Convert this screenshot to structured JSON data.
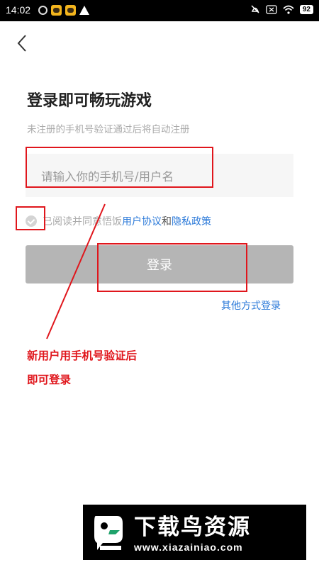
{
  "status_bar": {
    "time": "14:02",
    "battery": "92"
  },
  "page": {
    "title": "登录即可畅玩游戏",
    "subtitle": "未注册的手机号验证通过后将自动注册",
    "phone_placeholder": "请输入你的手机号/用户名",
    "agree_prefix": "已阅读并同意悟饭",
    "user_agreement": "用户协议",
    "and": "和",
    "privacy_policy": "隐私政策",
    "login_button": "登录",
    "other_login": "其他方式登录"
  },
  "annotation": {
    "line1": "新用户用手机号验证后",
    "line2": "即可登录",
    "color": "#e0161c"
  },
  "watermark": {
    "brand": "下载鸟资源",
    "url": "www.xiazainiao.com"
  },
  "colors": {
    "link": "#2c7ad9",
    "button_disabled": "#b5b5b5",
    "annotation": "#e0161c"
  }
}
